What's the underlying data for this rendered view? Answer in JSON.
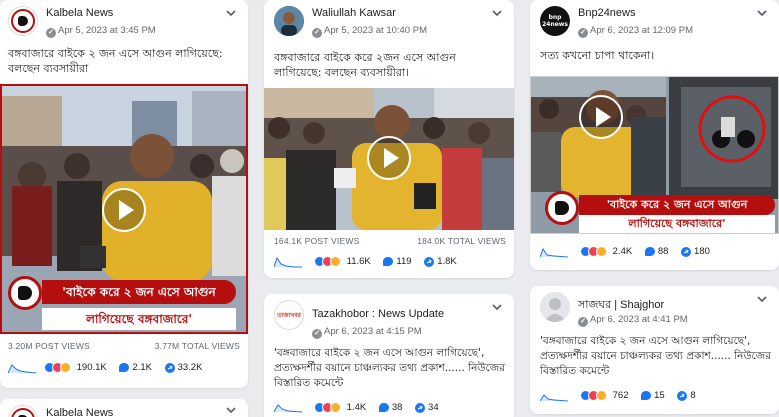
{
  "posts": [
    {
      "name": "Kalbela News",
      "meta": "Apr 5, 2023 at 3:45 PM",
      "text": "বঙ্গবাজারে বাইকে ২ জন এসে আগুন লাগিয়েছে: বলছেন ব্যবসায়ীরা",
      "banner_line1": "'বাইকে করে ২ জন এসে আগুন",
      "banner_line2": "লাগিয়েছে বঙ্গবাজারে'",
      "post_views": "3.20M POST VIEWS",
      "total_views": "3.77M TOTAL VIEWS",
      "reactions": "190.1K",
      "comments": "2.1K",
      "shares": "33.2K"
    },
    {
      "name": "Waliullah Kawsar",
      "meta": "Apr 5, 2023 at 10:40 PM",
      "text": "বঙ্গবাজারে বাইকে করে ২জন এসে আগুন লাগিয়েছে: বলছেন ব্যবসায়ীরা।",
      "post_views": "164.1K POST VIEWS",
      "total_views": "184.0K TOTAL VIEWS",
      "reactions": "11.6K",
      "comments": "119",
      "shares": "1.8K"
    },
    {
      "name": "Bnp24news",
      "meta": "Apr 6, 2023 at 12:09 PM",
      "text": "সত্য কখনো চাপা থাকেনা।",
      "logo_text": "bnp 24news",
      "banner_line1": "'বাইকে করে ২ জন এসে আগুন",
      "banner_line2": "লাগিয়েছে বঙ্গবাজারে'",
      "reactions": "2.4K",
      "comments": "88",
      "shares": "180"
    },
    {
      "name": "Tazakhobor : News Update",
      "meta": "Apr 6, 2023 at 4:15 PM",
      "text": "'বঙ্গবাজারে বাইকে ২ জন এসে আগুন লাগিয়েছে', প্রত্যক্ষদর্শীর বয়ানে চাঞ্চল্যকর তথ্য প্রকাশ...... নিউজের বিস্তারিত কমেন্টে",
      "logo_text": "তাজাখবর",
      "reactions": "1.4K",
      "comments": "38",
      "shares": "34"
    },
    {
      "name": "সাজঘর | Shajghor",
      "meta": "Apr 6, 2023 at 4:41 PM",
      "text": "'বঙ্গবাজারে বাইকে ২ জন এসে আগুন লাগিয়েছে', প্রত্যক্ষদর্শীর বয়ানে চাঞ্চল্যকর তথ্য প্রকাশ...... নিউজের বিস্তারিত কমেন্টে",
      "reactions": "762",
      "comments": "15",
      "shares": "8"
    },
    {
      "name": "Kalbela News"
    }
  ],
  "icons": {
    "privacy": "globe-icon",
    "menu": "chevron-down-icon",
    "comment": "comment-icon",
    "share": "share-icon"
  },
  "colors": {
    "brand_red": "#b50e0e",
    "like_blue": "#1877f2",
    "background": "#e9ebee"
  }
}
